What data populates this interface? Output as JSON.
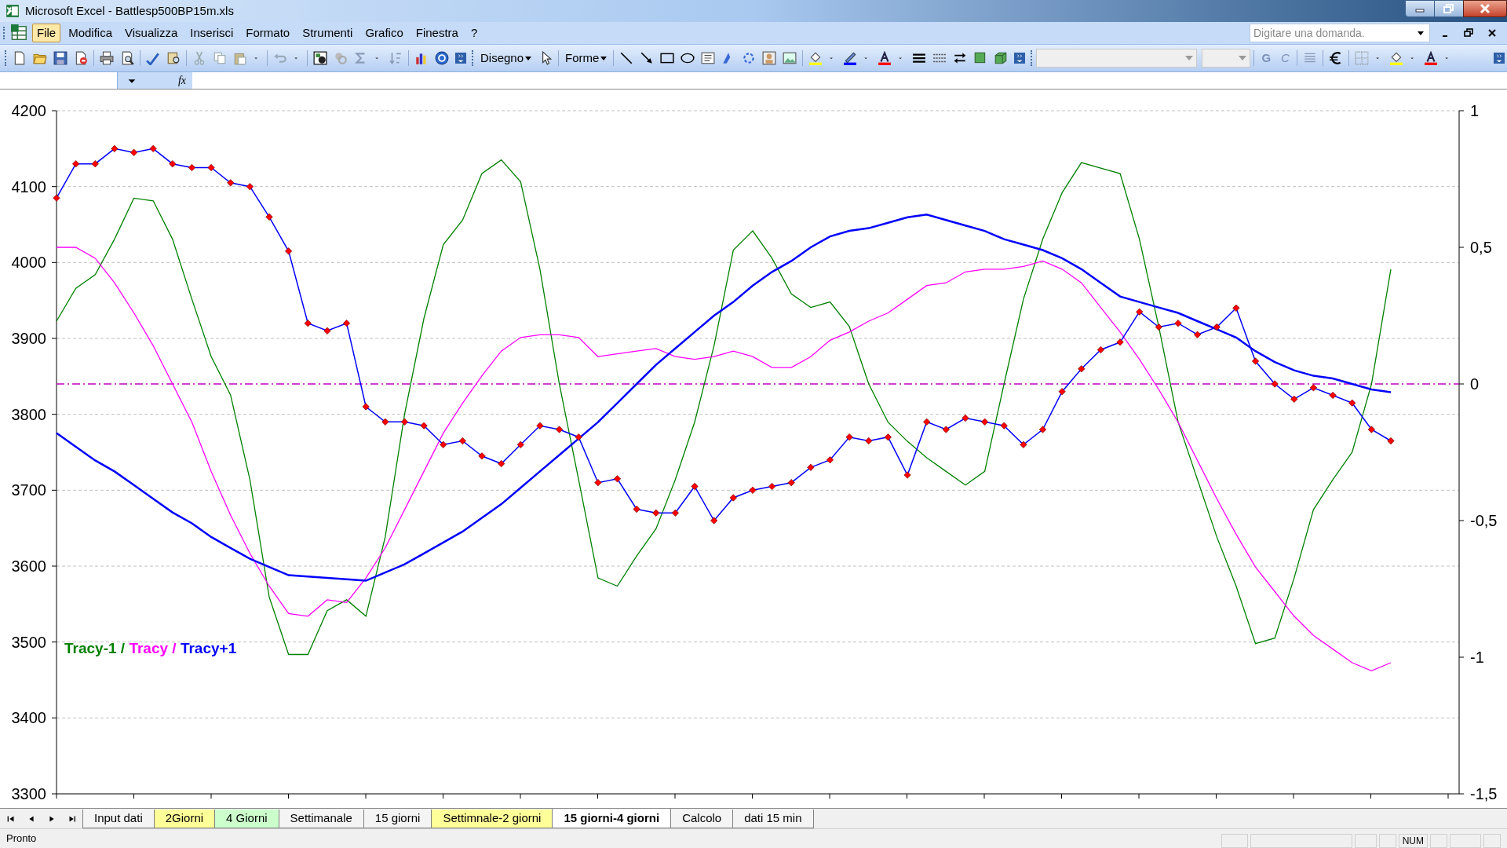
{
  "window": {
    "title": "Microsoft Excel - Battlesp500BP15m.xls"
  },
  "menu": [
    {
      "label": "File",
      "selected": true
    },
    {
      "label": "Modifica",
      "selected": false
    },
    {
      "label": "Visualizza",
      "selected": false
    },
    {
      "label": "Inserisci",
      "selected": false
    },
    {
      "label": "Formato",
      "selected": false
    },
    {
      "label": "Strumenti",
      "selected": false
    },
    {
      "label": "Grafico",
      "selected": false
    },
    {
      "label": "Finestra",
      "selected": false
    },
    {
      "label": "?",
      "selected": false
    }
  ],
  "help_search": {
    "placeholder": "Digitare una domanda."
  },
  "toolbar": {
    "drawing_menus": [
      {
        "label": "Disegno"
      },
      {
        "label": "Forme"
      }
    ],
    "format_buttons": [
      {
        "label": "G",
        "kind": "bold"
      },
      {
        "label": "C",
        "kind": "italic"
      }
    ]
  },
  "formula_bar": {
    "function_label": "fx"
  },
  "chart": {
    "chart_data": {
      "type": "line",
      "ylim": [
        3300,
        4200
      ],
      "yticks": [
        3300,
        3400,
        3500,
        3600,
        3700,
        3800,
        3900,
        4000,
        4100,
        4200
      ],
      "y2lim": [
        -1.5,
        1
      ],
      "y2ticks": [
        {
          "value": -1.5,
          "label": "-1,5"
        },
        {
          "value": -1,
          "label": "-1"
        },
        {
          "value": -0.5,
          "label": "-0,5"
        },
        {
          "value": 0,
          "label": "0"
        },
        {
          "value": 0.5,
          "label": "0,5"
        },
        {
          "value": 1,
          "label": "1"
        }
      ],
      "series": [
        {
          "color": "#ff0000",
          "marker": "diamond",
          "values": [
            4085,
            4130,
            4130,
            4150,
            4145,
            4150,
            4130,
            4125,
            4125,
            4105,
            4100,
            4060,
            4015,
            3920,
            3910,
            3920,
            3810,
            3790,
            3790,
            3785,
            3760,
            3765,
            3745,
            3735,
            3760,
            3785,
            3780,
            3770,
            3710,
            3715,
            3675,
            3670,
            3670,
            3705,
            3660,
            3690,
            3700,
            3705,
            3710,
            3730,
            3740,
            3770,
            3765,
            3770,
            3720,
            3790,
            3780,
            3795,
            3790,
            3785,
            3760,
            3780,
            3830,
            3860,
            3885,
            3895,
            3935,
            3915,
            3920,
            3905,
            3915,
            3940,
            3870,
            3840,
            3820,
            3835,
            3825,
            3815,
            3780,
            3765
          ]
        },
        {
          "name": "Tracy-1",
          "color": "#008000",
          "axis": "y2",
          "values": [
            0.23,
            0.35,
            0.4,
            0.53,
            0.68,
            0.67,
            0.53,
            0.31,
            0.1,
            -0.04,
            -0.35,
            -0.78,
            -0.99,
            -0.99,
            -0.83,
            -0.79,
            -0.85,
            -0.56,
            -0.11,
            0.24,
            0.51,
            0.6,
            0.77,
            0.82,
            0.74,
            0.42,
            0,
            -0.35,
            -0.71,
            -0.74,
            -0.63,
            -0.53,
            -0.35,
            -0.14,
            0.14,
            0.49,
            0.56,
            0.46,
            0.33,
            0.28,
            0.3,
            0.21,
            0,
            -0.14,
            -0.21,
            -0.27,
            -0.32,
            -0.37,
            -0.32,
            0,
            0.31,
            0.53,
            0.7,
            0.81,
            0.79,
            0.77,
            0.53,
            0.21,
            -0.14,
            -0.35,
            -0.56,
            -0.74,
            -0.95,
            -0.93,
            -0.71,
            -0.46,
            -0.35,
            -0.25,
            0,
            0.42
          ]
        },
        {
          "name": "Tracy",
          "color": "#ff00ff",
          "axis": "y2",
          "values": [
            0.5,
            0.5,
            0.46,
            0.37,
            0.26,
            0.14,
            0,
            -0.14,
            -0.32,
            -0.48,
            -0.62,
            -0.74,
            -0.84,
            -0.85,
            -0.79,
            -0.8,
            -0.71,
            -0.6,
            -0.46,
            -0.32,
            -0.18,
            -0.07,
            0.03,
            0.12,
            0.17,
            0.18,
            0.18,
            0.17,
            0.1,
            0.11,
            0.12,
            0.13,
            0.1,
            0.09,
            0.1,
            0.12,
            0.1,
            0.06,
            0.06,
            0.1,
            0.16,
            0.19,
            0.23,
            0.26,
            0.31,
            0.36,
            0.37,
            0.41,
            0.42,
            0.42,
            0.43,
            0.45,
            0.42,
            0.37,
            0.28,
            0.19,
            0.09,
            -0.02,
            -0.14,
            -0.28,
            -0.42,
            -0.55,
            -0.67,
            -0.76,
            -0.85,
            -0.92,
            -0.97,
            -1.02,
            -1.05,
            -1.02
          ]
        },
        {
          "name": "Tracy+1",
          "color": "#0000ff",
          "axis": "y2",
          "values": [
            -0.18,
            -0.23,
            -0.28,
            -0.32,
            -0.37,
            -0.42,
            -0.47,
            -0.51,
            -0.56,
            -0.6,
            -0.64,
            -0.67,
            -0.7,
            -0.705,
            -0.71,
            -0.715,
            -0.72,
            -0.69,
            -0.66,
            -0.62,
            -0.58,
            -0.54,
            -0.49,
            -0.44,
            -0.38,
            -0.32,
            -0.26,
            -0.2,
            -0.14,
            -0.07,
            0,
            0.07,
            0.13,
            0.19,
            0.25,
            0.3,
            0.36,
            0.41,
            0.45,
            0.5,
            0.54,
            0.56,
            0.57,
            0.59,
            0.61,
            0.62,
            0.6,
            0.58,
            0.56,
            0.53,
            0.51,
            0.49,
            0.46,
            0.42,
            0.37,
            0.32,
            0.3,
            0.28,
            0.26,
            0.23,
            0.2,
            0.17,
            0.12,
            0.08,
            0.05,
            0.03,
            0.02,
            0,
            -0.02,
            -0.03
          ]
        }
      ],
      "grid": true,
      "ref_lines": [
        {
          "value": 0,
          "axis": "y2",
          "color": "#c000c0"
        }
      ]
    },
    "legend_separator": "/"
  },
  "sheet_tabs": [
    {
      "label": "Input dati",
      "selected": false
    },
    {
      "label": "2Giorni",
      "selected": false,
      "color": "#ffff99"
    },
    {
      "label": "4 Giorni",
      "selected": false,
      "color": "#ccffcc"
    },
    {
      "label": "Settimanale",
      "selected": false
    },
    {
      "label": "15 giorni",
      "selected": false
    },
    {
      "label": "Settimnale-2 giorni",
      "selected": false,
      "color": "#ffff99"
    },
    {
      "label": "15 giorni-4 giorni",
      "selected": true
    },
    {
      "label": "Calcolo",
      "selected": false
    },
    {
      "label": "dati 15 min",
      "selected": false
    }
  ],
  "status_bar": {
    "mode": "Pronto",
    "indicators": [
      "NUM"
    ]
  }
}
